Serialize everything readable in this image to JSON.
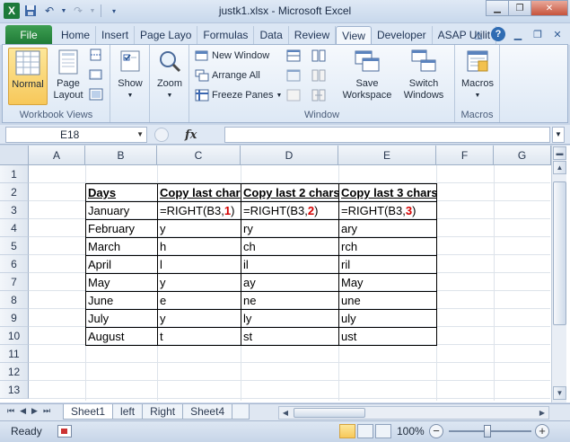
{
  "window": {
    "title": "justk1.xlsx  -  Microsoft Excel",
    "app_icon_letter": "X"
  },
  "ribbon_tabs": {
    "file": "File",
    "tabs": [
      "Home",
      "Insert",
      "Page Layo",
      "Formulas",
      "Data",
      "Review",
      "View",
      "Developer",
      "ASAP Utilit"
    ],
    "active_tab": "View"
  },
  "ribbon": {
    "workbook_views": {
      "label": "Workbook Views",
      "normal": "Normal",
      "page_layout_line1": "Page",
      "page_layout_line2": "Layout"
    },
    "show": {
      "label": "Show"
    },
    "zoom": {
      "label": "Zoom"
    },
    "window": {
      "label": "Window",
      "new_window": "New Window",
      "arrange_all": "Arrange All",
      "freeze_panes": "Freeze Panes",
      "save_workspace_line1": "Save",
      "save_workspace_line2": "Workspace",
      "switch_windows_line1": "Switch",
      "switch_windows_line2": "Windows"
    },
    "macros": {
      "label": "Macros",
      "button": "Macros"
    }
  },
  "formula_bar": {
    "name_box": "E18",
    "fx": "fx",
    "formula": ""
  },
  "sheet": {
    "columns": [
      "A",
      "B",
      "C",
      "D",
      "E",
      "F",
      "G"
    ],
    "rows": [
      "1",
      "2",
      "3",
      "4",
      "5",
      "6",
      "7",
      "8",
      "9",
      "10",
      "11",
      "12",
      "13"
    ],
    "table": {
      "headers": [
        "Days",
        "Copy last char",
        "Copy last 2 chars",
        "Copy last 3 chars"
      ],
      "formula_row": {
        "day": "January",
        "c": {
          "prefix": "=RIGHT(B3,",
          "arg": "1",
          "suffix": ")"
        },
        "d": {
          "prefix": "=RIGHT(B3,",
          "arg": "2",
          "suffix": ")"
        },
        "e": {
          "prefix": "=RIGHT(B3,",
          "arg": "3",
          "suffix": ")"
        }
      },
      "rows": [
        [
          "February",
          "y",
          "ry",
          "ary"
        ],
        [
          "March",
          "h",
          "ch",
          "rch"
        ],
        [
          "April",
          "l",
          "il",
          "ril"
        ],
        [
          "May",
          "y",
          "ay",
          "May"
        ],
        [
          "June",
          "e",
          "ne",
          "une"
        ],
        [
          "July",
          "y",
          "ly",
          "uly"
        ],
        [
          "August",
          "t",
          "st",
          "ust"
        ]
      ]
    },
    "sheet_tabs": [
      "Sheet1",
      "left",
      "Right",
      "Sheet4"
    ],
    "active_sheet": "Sheet1"
  },
  "status": {
    "ready": "Ready",
    "zoom": "100%",
    "minus": "−",
    "plus": "+"
  }
}
